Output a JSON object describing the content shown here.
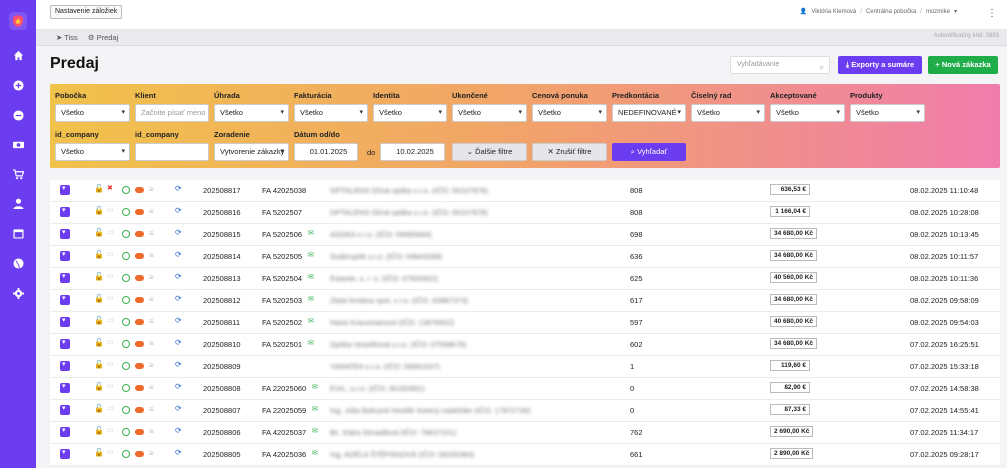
{
  "topbar": {
    "bookmark_label": "Nastavenie záložiek",
    "user_name": "Viktória Klemová",
    "branch": "Centrálna pobočka",
    "org": "mozmike",
    "auth_code_label": "Autentifikačný kód: 0893"
  },
  "breadcrumb": {
    "item1": "Tiss",
    "item2": "Predaj"
  },
  "page": {
    "title": "Predaj",
    "search_placeholder": "Vyhľadávanie",
    "export_label": "Exporty a sumáre",
    "new_order_label": "Nová zákazka"
  },
  "filters": {
    "pobocka": {
      "label": "Pobočka",
      "value": "Všetko"
    },
    "klient": {
      "label": "Klient",
      "placeholder": "Začnite písať meno"
    },
    "uhrada": {
      "label": "Úhrada",
      "value": "Všetko"
    },
    "fakturacia": {
      "label": "Fakturácia",
      "value": "Všetko"
    },
    "identita": {
      "label": "Identita",
      "value": "Všetko"
    },
    "ukoncene": {
      "label": "Ukončené",
      "value": "Všetko"
    },
    "cenova": {
      "label": "Cenová ponuka",
      "value": "Všetko"
    },
    "predkontacia": {
      "label": "Predkontácia",
      "value": "NEDEFINOVANÉ"
    },
    "ciselny": {
      "label": "Číselný rad",
      "value": "Všetko"
    },
    "akceptovane": {
      "label": "Akceptované",
      "value": "Všetko"
    },
    "produkty": {
      "label": "Produkty",
      "value": "Všetko"
    },
    "id_company1": {
      "label": "id_company",
      "value": "Všetko"
    },
    "id_company2": {
      "label": "id_company",
      "value": ""
    },
    "zoradenie": {
      "label": "Zoradenie",
      "value": "Vytvorenie zákazky"
    },
    "datum": {
      "label": "Dátum od/do",
      "from": "01.01.2025",
      "sep": "do",
      "to": "10.02.2025"
    },
    "more_filters": "Ďalšie filtre",
    "cancel_filter": "Zrušiť filtre",
    "search_btn": "Vyhľadať"
  },
  "rows": [
    {
      "num": "202508817",
      "inv": "FA 42025038",
      "mail": false,
      "flag": true,
      "customer": "OPTALENS Očná optika s.r.o. (IČO: 00107878)",
      "cnt": "808",
      "amount": "636,53 €",
      "date": "08.02.2025 11:10:48"
    },
    {
      "num": "202508816",
      "inv": "FA 5202507",
      "mail": false,
      "flag": false,
      "customer": "OPTALENS Očná optika s.r.o. (IČO: 00107878)",
      "cnt": "808",
      "amount": "1 166,04 €",
      "date": "08.02.2025 10:28:08"
    },
    {
      "num": "202508815",
      "inv": "FA 5202506",
      "mail": true,
      "flag": false,
      "customer": "ADDEA s.r.o. (IČO: 09665684)",
      "cnt": "698",
      "amount": "34 680,00 Kč",
      "date": "08.02.2025 10:13:45"
    },
    {
      "num": "202508814",
      "inv": "FA 5202505",
      "mail": true,
      "flag": false,
      "customer": "Suderoptik s.r.o. (IČO: 09643288)",
      "cnt": "636",
      "amount": "34 680,00 Kč",
      "date": "08.02.2025 10:11:57"
    },
    {
      "num": "202508813",
      "inv": "FA 5202504",
      "mail": true,
      "flag": false,
      "customer": "Estante, s. r. o. (IČO: 07600602)",
      "cnt": "625",
      "amount": "40 560,00 Kč",
      "date": "08.02.2025 10:11:36"
    },
    {
      "num": "202508812",
      "inv": "FA 5202503",
      "mail": true,
      "flag": false,
      "customer": "Zlatá fontána spol. s r.o. (IČO: 63887374)",
      "cnt": "617",
      "amount": "34 680,00 Kč",
      "date": "08.02.2025 09:58:09"
    },
    {
      "num": "202508811",
      "inv": "FA 5202502",
      "mail": true,
      "flag": false,
      "customer": "Hana Krausmanová (IČO: 13676602)",
      "cnt": "597",
      "amount": "40 680,00 Kč",
      "date": "08.02.2025 09:54:03"
    },
    {
      "num": "202508810",
      "inv": "FA 5202501",
      "mail": true,
      "flag": false,
      "customer": "Optika Veselíková s.r.o. (IČO: 07558678)",
      "cnt": "602",
      "amount": "34 680,00 Kč",
      "date": "07.02.2025 16:25:51"
    },
    {
      "num": "202508809",
      "inv": "",
      "mail": false,
      "flag": false,
      "customer": "YARATEA s.r.o. (IČO: 06891637)",
      "cnt": "1",
      "amount": "119,60 €",
      "date": "07.02.2025 15:33:18"
    },
    {
      "num": "202508808",
      "inv": "FA 22025060",
      "mail": true,
      "flag": false,
      "customer": "EVIL, s.r.o. (IČO: 36182891)",
      "cnt": "0",
      "amount": "82,90 €",
      "date": "07.02.2025 14:58:38"
    },
    {
      "num": "202508807",
      "inv": "FA 22025059",
      "mail": true,
      "flag": false,
      "customer": "Ing. Júlia Bohumil Hostilé Svetný nadežder (IČO: 17872736)",
      "cnt": "0",
      "amount": "87,33 €",
      "date": "07.02.2025 14:55:41"
    },
    {
      "num": "202508806",
      "inv": "FA 42025037",
      "mail": true,
      "flag": false,
      "customer": "Bc. Klára Strnadlová (IČO: 79637101)",
      "cnt": "762",
      "amount": "2 690,00 Kč",
      "date": "07.02.2025 11:34:17"
    },
    {
      "num": "202508805",
      "inv": "FA 42025036",
      "mail": true,
      "flag": false,
      "customer": "Ing. ADÉLA ŠTĚPÁNOVÁ (IČO: 08205384)",
      "cnt": "661",
      "amount": "2 890,00 Kč",
      "date": "07.02.2025 09:28:17"
    }
  ]
}
